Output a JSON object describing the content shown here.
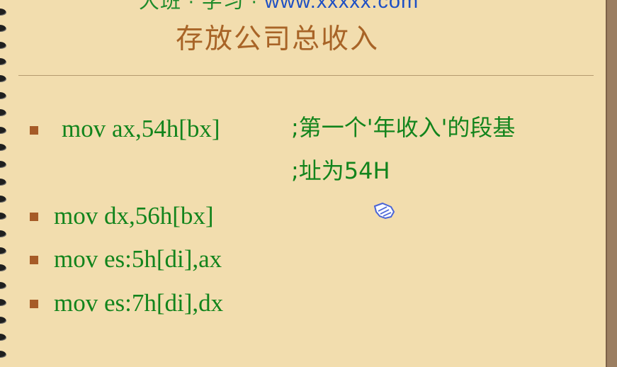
{
  "header": {
    "prefix": "大班 · 学习 · ",
    "url": "www.xxxxx.com"
  },
  "slide": {
    "title": "存放公司总收入",
    "lines": [
      {
        "code": "mov ax,54h[bx]",
        "comment": ";第一个'年收入'的段基"
      },
      {
        "comment": ";址为54H"
      },
      {
        "code": "mov dx,56h[bx]"
      },
      {
        "code": "mov es:5h[di],ax"
      },
      {
        "code": "mov es:7h[di],dx"
      }
    ]
  },
  "icons": {
    "bullet": "square-bullet",
    "cursor": "hand-pointer-icon"
  },
  "colors": {
    "background": "#f2ddae",
    "title": "#a86427",
    "code": "#12841c",
    "bullet": "#a65b27",
    "header_url": "#1e4fc4"
  }
}
